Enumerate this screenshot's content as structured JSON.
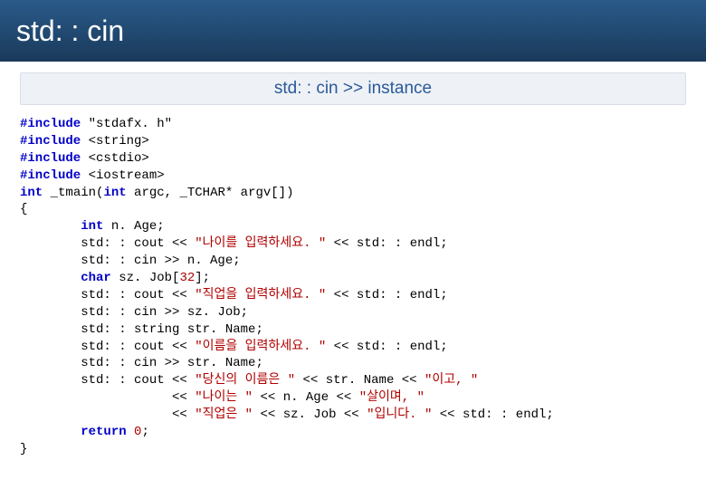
{
  "header": {
    "title": "std: : cin"
  },
  "subheader": {
    "text": "std: : cin >> instance"
  },
  "code": {
    "kw_include": "#include",
    "inc1": " \"stdafx. h\"",
    "inc2": " <string>",
    "inc3": " <cstdio>",
    "inc4": " <iostream>",
    "kw_int": "int",
    "main_sig1": " _tmain(",
    "main_sig2": " argc, _TCHAR* argv[])",
    "brace_open": "{",
    "nage_decl": " n. Age;",
    "cout_pre": "        std: : cout << ",
    "s_age": "\"나이를 입력하세요. \"",
    "endl_tail": " << std: : endl;",
    "cin_age": "        std: : cin >> n. Age;",
    "kw_char": "char",
    "szjob_decl": " sz. Job[",
    "szjob_size": "32",
    "szjob_end": "];",
    "s_job": "\"직업을 입력하세요. \"",
    "cin_job": "        std: : cin >> sz. Job;",
    "strname_decl": "        std: : string str. Name;",
    "s_name": "\"이름을 입력하세요. \"",
    "cin_name": "        std: : cin >> str. Name;",
    "s_your_name": "\"당신의 이름은 \"",
    "after_name": " << str. Name << ",
    "s_igo": "\"이고, \"",
    "indent_chain": "                    << ",
    "s_age_is": "\"나이는 \"",
    "after_age": " << n. Age << ",
    "s_sal": "\"살이며, \"",
    "s_job_is": "\"직업은 \"",
    "after_job": " << sz. Job << ",
    "s_ipnida": "\"입니다. \"",
    "kw_return": "return",
    "ret_tail": " ",
    "zero": "0",
    "semi": ";",
    "brace_close": "}",
    "indent8": "        "
  }
}
